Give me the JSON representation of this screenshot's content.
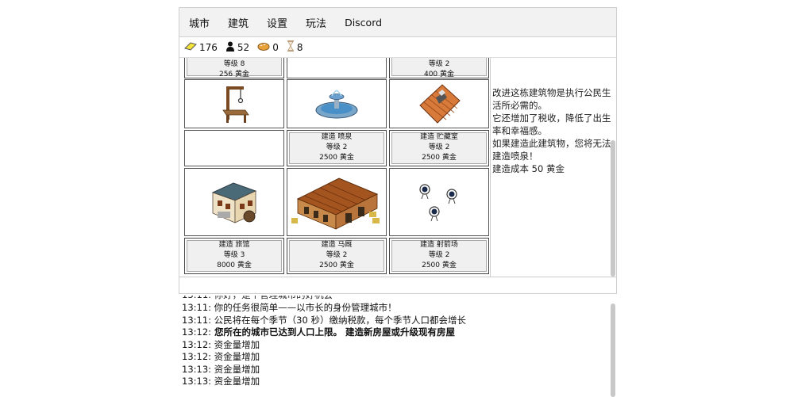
{
  "menu": {
    "items": [
      "城市",
      "建筑",
      "设置",
      "玩法",
      "Discord"
    ]
  },
  "status": {
    "gold": "176",
    "population": "52",
    "food": "0",
    "time": "8"
  },
  "grid": {
    "row1": {
      "left": {
        "level": "等级 8",
        "cost": "256 黄金"
      },
      "right": {
        "level": "等级 2",
        "cost": "400 黄金"
      }
    },
    "row2_icons": [
      "gallows-icon",
      "fountain-icon",
      "storehouse-icon"
    ],
    "row3": {
      "middle": {
        "action": "建造 喷泉",
        "level": "等级 2",
        "cost": "2500 黄金"
      },
      "right": {
        "action": "建造 贮藏室",
        "level": "等级 2",
        "cost": "2500 黄金"
      }
    },
    "row4_icons": [
      "tavern-icon",
      "stable-icon",
      "archery-targets-icon"
    ],
    "row5": [
      {
        "action": "建造 旅馆",
        "level": "等级 3",
        "cost": "8000 黄金"
      },
      {
        "action": "建造 马厩",
        "level": "等级 2",
        "cost": "2500 黄金"
      },
      {
        "action": "建造 射箭场",
        "level": "等级 2",
        "cost": "2500 黄金"
      }
    ]
  },
  "description": {
    "line1": "改进这栋建筑物是执行公民生活所必需的。",
    "line2": "它还增加了税收，降低了出生率和幸福感。",
    "line3": "如果建造此建筑物，您将无法建造喷泉！",
    "line4": "建造成本 50 黄金"
  },
  "log": [
    {
      "time": "13:11:",
      "text": "你的任务很简单——以市长的身份管理城市！",
      "bold": false
    },
    {
      "time": "13:11:",
      "text": "公民将在每个季节（30 秒）缴纳税款，每个季节人口都会增长",
      "bold": false
    },
    {
      "time": "13:12:",
      "text": "  您所在的城市已达到人口上限。 建造新房屋或升级现有房屋",
      "bold": true
    },
    {
      "time": "13:12:",
      "text": "资金量增加",
      "bold": false
    },
    {
      "time": "13:12:",
      "text": "资金量增加",
      "bold": false
    },
    {
      "time": "13:13:",
      "text": "资金量增加",
      "bold": false
    },
    {
      "time": "13:13:",
      "text": "资金量增加",
      "bold": false
    }
  ]
}
